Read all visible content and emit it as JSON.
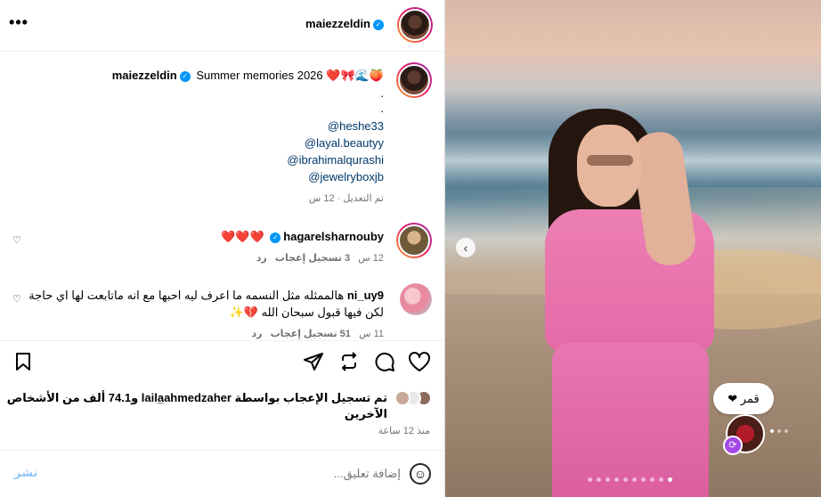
{
  "header": {
    "username": "maiezzeldin",
    "more_icon": "ellipsis-icon"
  },
  "caption": {
    "username": "maiezzeldin",
    "text": "Summer memories 2026 ❤️🎀🌊🍑",
    "dots": [
      ".",
      "."
    ],
    "mentions": [
      "@heshe33",
      "@layal.beautyy",
      "@ibrahimalqurashi",
      "@jewelryboxjb"
    ],
    "meta": "تم التعديل · 12 س"
  },
  "comments": [
    {
      "username": "hagarelsharnouby",
      "verified": true,
      "text": "❤️❤️❤️",
      "time": "12 س",
      "likes": "3 تسجيل إعجاب",
      "reply": "رد"
    },
    {
      "username": "ni_uy9",
      "verified": false,
      "text": "هالممثله مثل النسمه ما اعرف ليه احبها مع انه ماتابعت لها اي حاجة لكن فيها قبول سبحان الله 💔✨",
      "time": "11 س",
      "likes": "51 تسجيل إعجاب",
      "reply": "رد"
    }
  ],
  "likes": {
    "text": "تم تسجيل الإعجاب بواسطة laila̲ahmedzaher و74.1 ألف من الأشخاص الآخرين",
    "time": "منذ 12 ساعة"
  },
  "add_comment": {
    "placeholder": "إضافة تعليق...",
    "post_label": "نشر"
  },
  "photo": {
    "tag_label": "قمر ❤",
    "accent": "#e56aa8"
  }
}
